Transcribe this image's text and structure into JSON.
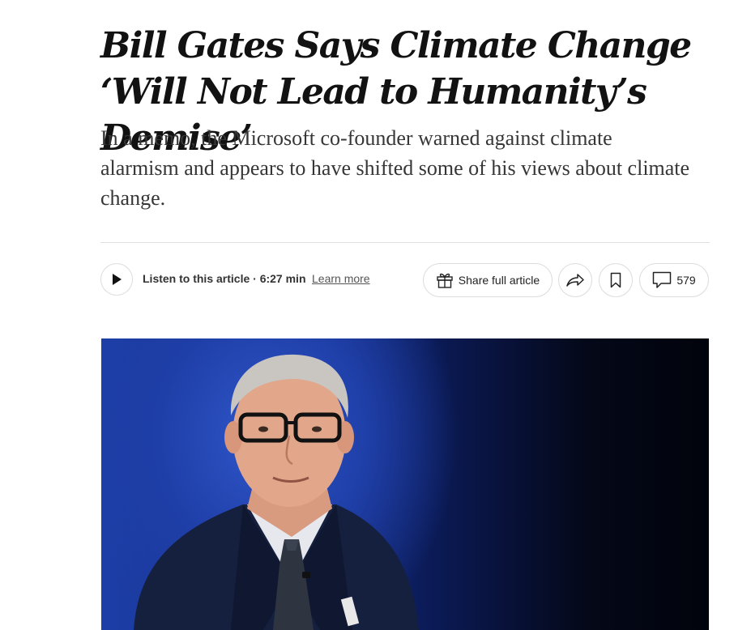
{
  "article": {
    "headline": "Bill Gates Says Climate Change ‘Will Not Lead to Humanity’s Demise’",
    "summary": "In a memo, the Microsoft co-founder warned against climate alarmism and appears to have shifted some of his views about climate change."
  },
  "toolbar": {
    "listen_label": "Listen to this article · 6:27 min",
    "learn_more": "Learn more",
    "share_label": "Share full article",
    "comment_count": "579"
  },
  "icons": {
    "play": "play-icon",
    "gift": "gift-icon",
    "share": "share-arrow-icon",
    "save": "bookmark-icon",
    "comments": "comment-bubble-icon"
  },
  "colors": {
    "text": "#121212",
    "summary": "#363636",
    "border": "#dcdcdc",
    "photo_background": "#1c3ea6"
  }
}
